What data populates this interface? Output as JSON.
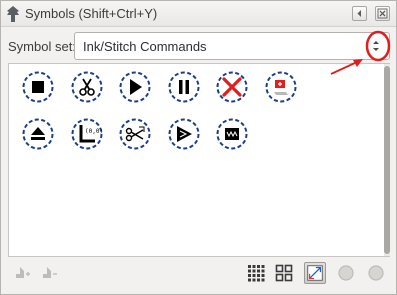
{
  "window": {
    "title": "Symbols (Shift+Ctrl+Y)",
    "app_icon": "inkscape-icon",
    "menu_icon": "menu-icon",
    "close_icon": "close-icon"
  },
  "symbol_set": {
    "label": "Symbol set:",
    "value": "Ink/Stitch Commands",
    "arrows_icon": "spin-arrows-icon"
  },
  "annotation": {
    "color": "#e21d1d"
  },
  "symbols": [
    {
      "icon": "stop-icon",
      "color": "#000000"
    },
    {
      "icon": "trim-scissors-icon",
      "color": "#000000"
    },
    {
      "icon": "play-icon",
      "color": "#000000"
    },
    {
      "icon": "pause-icon",
      "color": "#000000"
    },
    {
      "icon": "ignore-x-icon",
      "color": "#e21d1d"
    },
    {
      "icon": "ignore-layer-icon",
      "color": "#e21d1d"
    },
    {
      "icon": "eject-icon",
      "color": "#000000"
    },
    {
      "icon": "origin-icon",
      "color": "#000000"
    },
    {
      "icon": "cut-scissors-icon",
      "color": "#000000"
    },
    {
      "icon": "fill-start-icon",
      "color": "#000000"
    },
    {
      "icon": "fill-end-icon",
      "color": "#000000"
    }
  ],
  "ring_color": "#1a3d8f",
  "bottom_bar": {
    "left": [
      "add-symbol-icon",
      "remove-symbol-icon"
    ],
    "right": [
      "large-grid-icon",
      "small-grid-icon",
      "fit-view-icon",
      "zoom-out-icon",
      "zoom-in-icon"
    ]
  }
}
